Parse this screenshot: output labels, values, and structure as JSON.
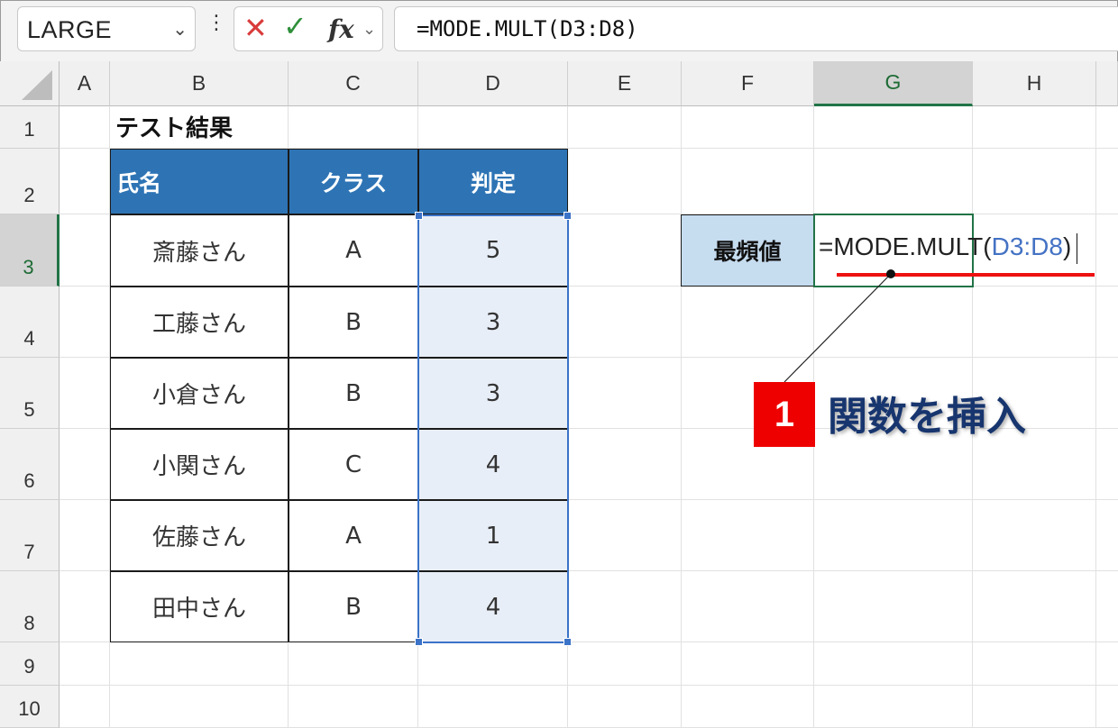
{
  "formula_bar": {
    "name_box": "LARGE",
    "fx": "fx",
    "formula": "=MODE.MULT(D3:D8)"
  },
  "columns": [
    "A",
    "B",
    "C",
    "D",
    "E",
    "F",
    "G",
    "H"
  ],
  "rows": [
    "1",
    "2",
    "3",
    "4",
    "5",
    "6",
    "7",
    "8",
    "9",
    "10"
  ],
  "selected_column": "G",
  "selected_row": "3",
  "sheet": {
    "title": "テスト結果",
    "headers": [
      "氏名",
      "クラス",
      "判定"
    ],
    "records": [
      [
        "斎藤さん",
        "A",
        "5"
      ],
      [
        "工藤さん",
        "B",
        "3"
      ],
      [
        "小倉さん",
        "B",
        "3"
      ],
      [
        "小関さん",
        "C",
        "4"
      ],
      [
        "佐藤さん",
        "A",
        "1"
      ],
      [
        "田中さん",
        "B",
        "4"
      ]
    ],
    "mode_label": "最頻値",
    "edit_prefix": "=MODE.MULT(",
    "edit_ref": "D3:D8",
    "edit_suffix": ")"
  },
  "annotation": {
    "step": "1",
    "text": "関数を挿入"
  },
  "colors": {
    "header_fill": "#2e74b5",
    "selection": "#3b73c8",
    "active": "#217346",
    "badge": "#ee0000",
    "callout_text": "#17356e"
  }
}
